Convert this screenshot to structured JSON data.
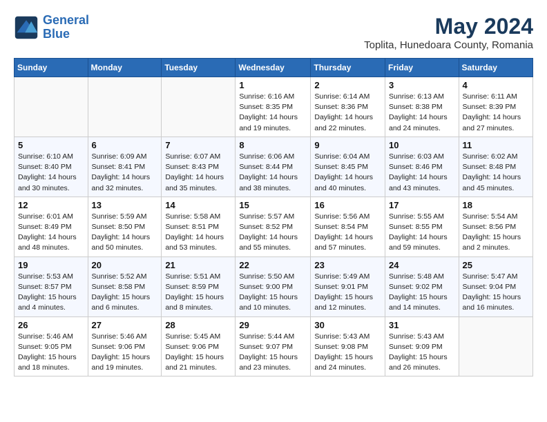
{
  "header": {
    "logo_line1": "General",
    "logo_line2": "Blue",
    "month_year": "May 2024",
    "location": "Toplita, Hunedoara County, Romania"
  },
  "days_of_week": [
    "Sunday",
    "Monday",
    "Tuesday",
    "Wednesday",
    "Thursday",
    "Friday",
    "Saturday"
  ],
  "weeks": [
    [
      {
        "day": "",
        "info": ""
      },
      {
        "day": "",
        "info": ""
      },
      {
        "day": "",
        "info": ""
      },
      {
        "day": "1",
        "info": "Sunrise: 6:16 AM\nSunset: 8:35 PM\nDaylight: 14 hours and 19 minutes."
      },
      {
        "day": "2",
        "info": "Sunrise: 6:14 AM\nSunset: 8:36 PM\nDaylight: 14 hours and 22 minutes."
      },
      {
        "day": "3",
        "info": "Sunrise: 6:13 AM\nSunset: 8:38 PM\nDaylight: 14 hours and 24 minutes."
      },
      {
        "day": "4",
        "info": "Sunrise: 6:11 AM\nSunset: 8:39 PM\nDaylight: 14 hours and 27 minutes."
      }
    ],
    [
      {
        "day": "5",
        "info": "Sunrise: 6:10 AM\nSunset: 8:40 PM\nDaylight: 14 hours and 30 minutes."
      },
      {
        "day": "6",
        "info": "Sunrise: 6:09 AM\nSunset: 8:41 PM\nDaylight: 14 hours and 32 minutes."
      },
      {
        "day": "7",
        "info": "Sunrise: 6:07 AM\nSunset: 8:43 PM\nDaylight: 14 hours and 35 minutes."
      },
      {
        "day": "8",
        "info": "Sunrise: 6:06 AM\nSunset: 8:44 PM\nDaylight: 14 hours and 38 minutes."
      },
      {
        "day": "9",
        "info": "Sunrise: 6:04 AM\nSunset: 8:45 PM\nDaylight: 14 hours and 40 minutes."
      },
      {
        "day": "10",
        "info": "Sunrise: 6:03 AM\nSunset: 8:46 PM\nDaylight: 14 hours and 43 minutes."
      },
      {
        "day": "11",
        "info": "Sunrise: 6:02 AM\nSunset: 8:48 PM\nDaylight: 14 hours and 45 minutes."
      }
    ],
    [
      {
        "day": "12",
        "info": "Sunrise: 6:01 AM\nSunset: 8:49 PM\nDaylight: 14 hours and 48 minutes."
      },
      {
        "day": "13",
        "info": "Sunrise: 5:59 AM\nSunset: 8:50 PM\nDaylight: 14 hours and 50 minutes."
      },
      {
        "day": "14",
        "info": "Sunrise: 5:58 AM\nSunset: 8:51 PM\nDaylight: 14 hours and 53 minutes."
      },
      {
        "day": "15",
        "info": "Sunrise: 5:57 AM\nSunset: 8:52 PM\nDaylight: 14 hours and 55 minutes."
      },
      {
        "day": "16",
        "info": "Sunrise: 5:56 AM\nSunset: 8:54 PM\nDaylight: 14 hours and 57 minutes."
      },
      {
        "day": "17",
        "info": "Sunrise: 5:55 AM\nSunset: 8:55 PM\nDaylight: 14 hours and 59 minutes."
      },
      {
        "day": "18",
        "info": "Sunrise: 5:54 AM\nSunset: 8:56 PM\nDaylight: 15 hours and 2 minutes."
      }
    ],
    [
      {
        "day": "19",
        "info": "Sunrise: 5:53 AM\nSunset: 8:57 PM\nDaylight: 15 hours and 4 minutes."
      },
      {
        "day": "20",
        "info": "Sunrise: 5:52 AM\nSunset: 8:58 PM\nDaylight: 15 hours and 6 minutes."
      },
      {
        "day": "21",
        "info": "Sunrise: 5:51 AM\nSunset: 8:59 PM\nDaylight: 15 hours and 8 minutes."
      },
      {
        "day": "22",
        "info": "Sunrise: 5:50 AM\nSunset: 9:00 PM\nDaylight: 15 hours and 10 minutes."
      },
      {
        "day": "23",
        "info": "Sunrise: 5:49 AM\nSunset: 9:01 PM\nDaylight: 15 hours and 12 minutes."
      },
      {
        "day": "24",
        "info": "Sunrise: 5:48 AM\nSunset: 9:02 PM\nDaylight: 15 hours and 14 minutes."
      },
      {
        "day": "25",
        "info": "Sunrise: 5:47 AM\nSunset: 9:04 PM\nDaylight: 15 hours and 16 minutes."
      }
    ],
    [
      {
        "day": "26",
        "info": "Sunrise: 5:46 AM\nSunset: 9:05 PM\nDaylight: 15 hours and 18 minutes."
      },
      {
        "day": "27",
        "info": "Sunrise: 5:46 AM\nSunset: 9:06 PM\nDaylight: 15 hours and 19 minutes."
      },
      {
        "day": "28",
        "info": "Sunrise: 5:45 AM\nSunset: 9:06 PM\nDaylight: 15 hours and 21 minutes."
      },
      {
        "day": "29",
        "info": "Sunrise: 5:44 AM\nSunset: 9:07 PM\nDaylight: 15 hours and 23 minutes."
      },
      {
        "day": "30",
        "info": "Sunrise: 5:43 AM\nSunset: 9:08 PM\nDaylight: 15 hours and 24 minutes."
      },
      {
        "day": "31",
        "info": "Sunrise: 5:43 AM\nSunset: 9:09 PM\nDaylight: 15 hours and 26 minutes."
      },
      {
        "day": "",
        "info": ""
      }
    ]
  ]
}
